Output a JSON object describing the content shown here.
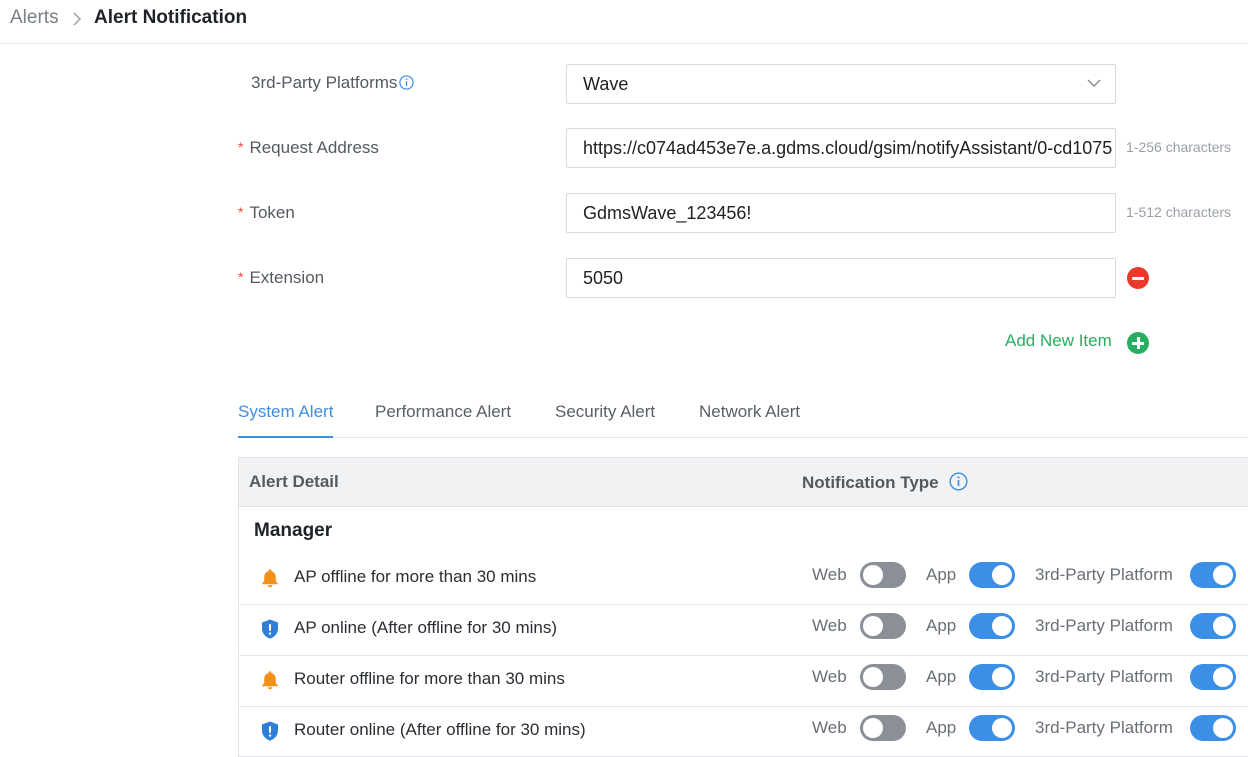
{
  "breadcrumb": {
    "root": "Alerts",
    "current": "Alert Notification"
  },
  "form": {
    "platform": {
      "label": "3rd-Party Platforms",
      "value": "Wave"
    },
    "request_address": {
      "label": "Request Address",
      "value": "https://c074ad453e7e.a.gdms.cloud/gsim/notifyAssistant/0-cd1075",
      "hint": "1-256 characters"
    },
    "token": {
      "label": "Token",
      "value": "GdmsWave_123456!",
      "hint": "1-512 characters"
    },
    "extension": {
      "label": "Extension",
      "value": "5050"
    },
    "add_item": "Add New Item",
    "required_mark": "*"
  },
  "tabs": [
    "System Alert",
    "Performance Alert",
    "Security Alert",
    "Network Alert"
  ],
  "active_tab": "System Alert",
  "table": {
    "headers": {
      "alert_detail": "Alert Detail",
      "notification_type": "Notification Type"
    },
    "group": "Manager",
    "channel_labels": {
      "web": "Web",
      "app": "App",
      "third_party": "3rd-Party Platform"
    },
    "rows": [
      {
        "icon": "bell-icon",
        "text": "AP offline for more than 30 mins",
        "web": false,
        "app": true,
        "third_party": true
      },
      {
        "icon": "shield-icon",
        "text": "AP online (After offline for 30 mins)",
        "web": false,
        "app": true,
        "third_party": true
      },
      {
        "icon": "bell-icon",
        "text": "Router offline for more than 30 mins",
        "web": false,
        "app": true,
        "third_party": true
      },
      {
        "icon": "shield-icon",
        "text": "Router online (After offline for 30 mins)",
        "web": false,
        "app": true,
        "third_party": true
      }
    ]
  },
  "colors": {
    "accent": "#3d8fe0",
    "success": "#27ae60",
    "danger": "#e8392b",
    "warning": "#f39019"
  }
}
